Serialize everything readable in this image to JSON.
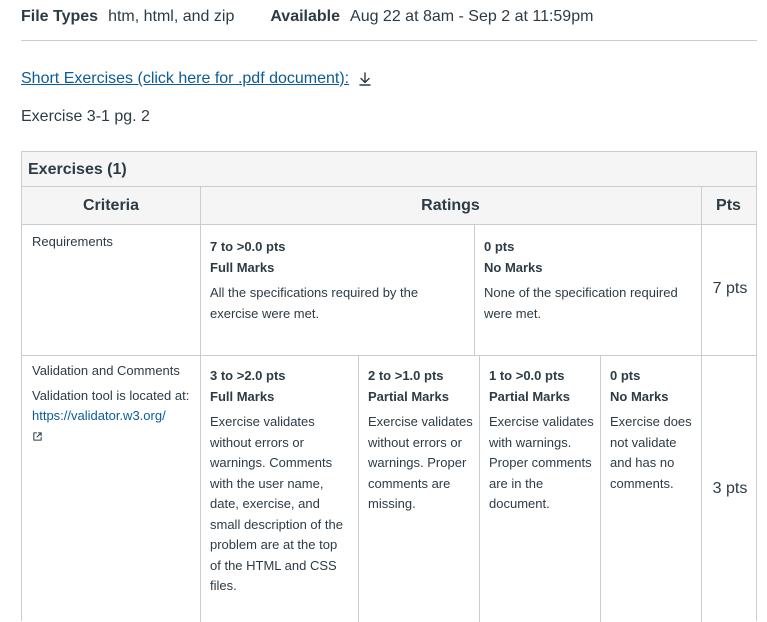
{
  "meta": {
    "file_types_label": "File Types",
    "file_types_value": "htm, html, and zip",
    "available_label": "Available",
    "available_value": "Aug 22 at 8am - Sep 2 at 11:59pm"
  },
  "short_exercises_link": "Short Exercises (click here for .pdf document):",
  "exercise_text": "Exercise 3-1 pg. 2",
  "rubric": {
    "title": "Exercises (1)",
    "headers": {
      "criteria": "Criteria",
      "ratings": "Ratings",
      "pts": "Pts"
    },
    "rows": [
      {
        "criterion": "Requirements",
        "ratings": [
          {
            "pts": "7 to >0.0 pts",
            "label": "Full Marks",
            "desc": "All the specifications required by the exercise were met."
          },
          {
            "pts": "0 pts",
            "label": "No Marks",
            "desc": "None of the specification required were met."
          }
        ],
        "points": "7 pts"
      },
      {
        "criterion": "Validation and Comments",
        "criterion_desc": "Validation tool is located at:",
        "criterion_link": "https://validator.w3.org/",
        "ratings": [
          {
            "pts": "3 to >2.0 pts",
            "label": "Full Marks",
            "desc": "Exercise validates without errors or warnings. Comments with the user name, date, exercise, and small description of the problem are at the top of the HTML and CSS files."
          },
          {
            "pts": "2 to >1.0 pts",
            "label": "Partial Marks",
            "desc": "Exercise validates without errors or warnings. Proper comments are missing."
          },
          {
            "pts": "1 to >0.0 pts",
            "label": "Partial Marks",
            "desc": "Exercise validates with warnings. Proper comments are in the document."
          },
          {
            "pts": "0 pts",
            "label": "No Marks",
            "desc": "Exercise does not validate and has no comments."
          }
        ],
        "points": "3 pts"
      }
    ]
  },
  "icons": {
    "download": "download-icon",
    "external_link": "external-link-icon"
  },
  "colors": {
    "link": "#0b5b9a",
    "text": "#2d3b45",
    "border": "#c7cdd1",
    "header_bg": "#f5f5f5"
  }
}
